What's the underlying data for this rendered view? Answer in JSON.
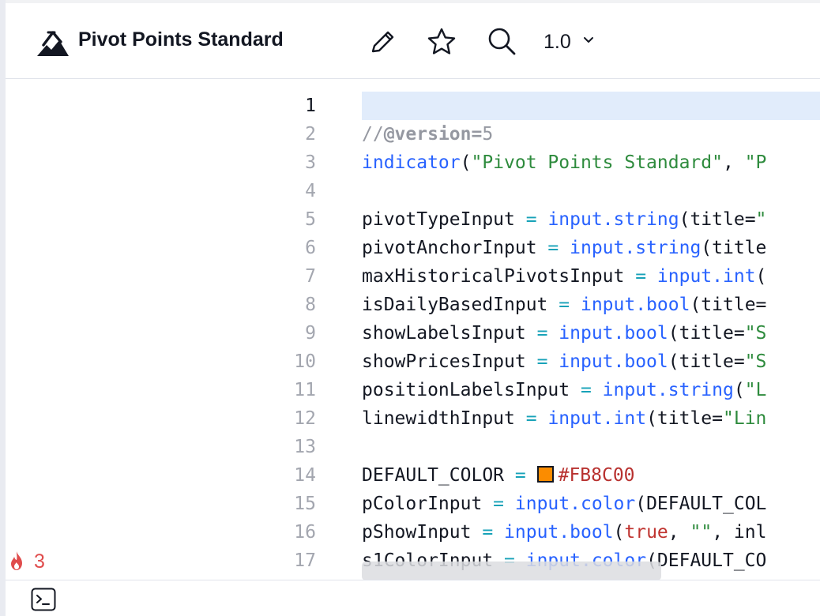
{
  "header": {
    "title": "Pivot Points Standard",
    "version": "1.0",
    "icons": [
      "logo-icon",
      "pencil-icon",
      "star-icon",
      "search-icon",
      "chevron-down-icon"
    ]
  },
  "editor": {
    "active_line": "1",
    "line_numbers": [
      "1",
      "2",
      "3",
      "4",
      "5",
      "6",
      "7",
      "8",
      "9",
      "10",
      "11",
      "12",
      "13",
      "14",
      "15",
      "16",
      "17"
    ],
    "code": {
      "l2_comment": "//",
      "l2_directive": "@version=",
      "l2_value": "5",
      "l3_fn": "indicator",
      "l3_open": "(",
      "l3_str1": "\"Pivot Points Standard\"",
      "l3_sep": ", ",
      "l3_str2": "\"P",
      "l5_var": "pivotTypeInput ",
      "l5_op": "=",
      "l5_fn": "input.string",
      "l5_rest": "(title=",
      "l5_str": "\"",
      "l6_var": "pivotAnchorInput ",
      "l6_op": "=",
      "l6_fn": "input.string",
      "l6_rest": "(title",
      "l7_var": "maxHistoricalPivotsInput ",
      "l7_op": "=",
      "l7_fn": "input.int",
      "l7_rest": "(",
      "l8_var": "isDailyBasedInput ",
      "l8_op": "=",
      "l8_fn": "input.bool",
      "l8_rest": "(title=",
      "l9_var": "showLabelsInput ",
      "l9_op": "=",
      "l9_fn": "input.bool",
      "l9_rest": "(title=",
      "l9_str": "\"S",
      "l10_var": "showPricesInput ",
      "l10_op": "=",
      "l10_fn": "input.bool",
      "l10_rest": "(title=",
      "l10_str": "\"S",
      "l11_var": "positionLabelsInput ",
      "l11_op": "=",
      "l11_fn": "input.string",
      "l11_rest": "(",
      "l11_str": "\"L",
      "l12_var": "linewidthInput ",
      "l12_op": "=",
      "l12_fn": "input.int",
      "l12_rest": "(title=",
      "l12_str": "\"Lin",
      "l14_var": "DEFAULT_COLOR ",
      "l14_op": "=",
      "l14_hex": "#FB8C00",
      "l15_var": "pColorInput ",
      "l15_op": "=",
      "l15_fn": "input.color",
      "l15_rest": "(DEFAULT_COL",
      "l16_var": "pShowInput ",
      "l16_op": "=",
      "l16_fn": "input.bool",
      "l16_open": "(",
      "l16_kw": "true",
      "l16_sep": ", ",
      "l16_str": "\"\"",
      "l16_rest": ", inl",
      "l17_var": "s1ColorInput ",
      "l17_op": "=",
      "l17_fn": "input.color",
      "l17_rest": "(DEFAULT_CO"
    },
    "swatch_color": "#FB8C00"
  },
  "status": {
    "issues_count": "3",
    "icons": [
      "fire-icon",
      "terminal-icon"
    ]
  }
}
